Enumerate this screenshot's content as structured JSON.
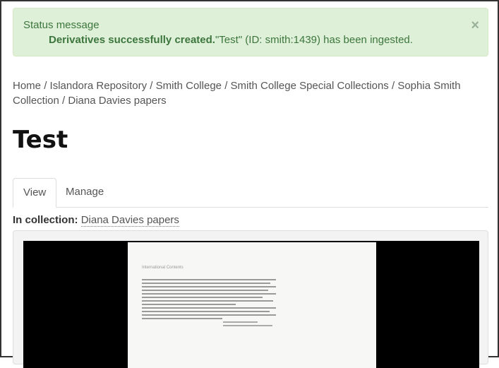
{
  "status": {
    "title": "Status message",
    "bold_text": "Derivatives successfully created.",
    "rest_text": "\"Test\" (ID: smith:1439) has been ingested.",
    "close_glyph": "×"
  },
  "breadcrumb": {
    "items": [
      "Home",
      "Islandora Repository",
      "Smith College",
      "Smith College Special Collections",
      "Sophia Smith Collection",
      "Diana Davies papers"
    ],
    "separator": "/"
  },
  "page_title": "Test",
  "tabs": [
    {
      "label": "View",
      "active": true
    },
    {
      "label": "Manage",
      "active": false
    }
  ],
  "collection": {
    "label": "In collection:",
    "link": "Diana Davies papers"
  },
  "document": {
    "heading": "International Contents"
  }
}
